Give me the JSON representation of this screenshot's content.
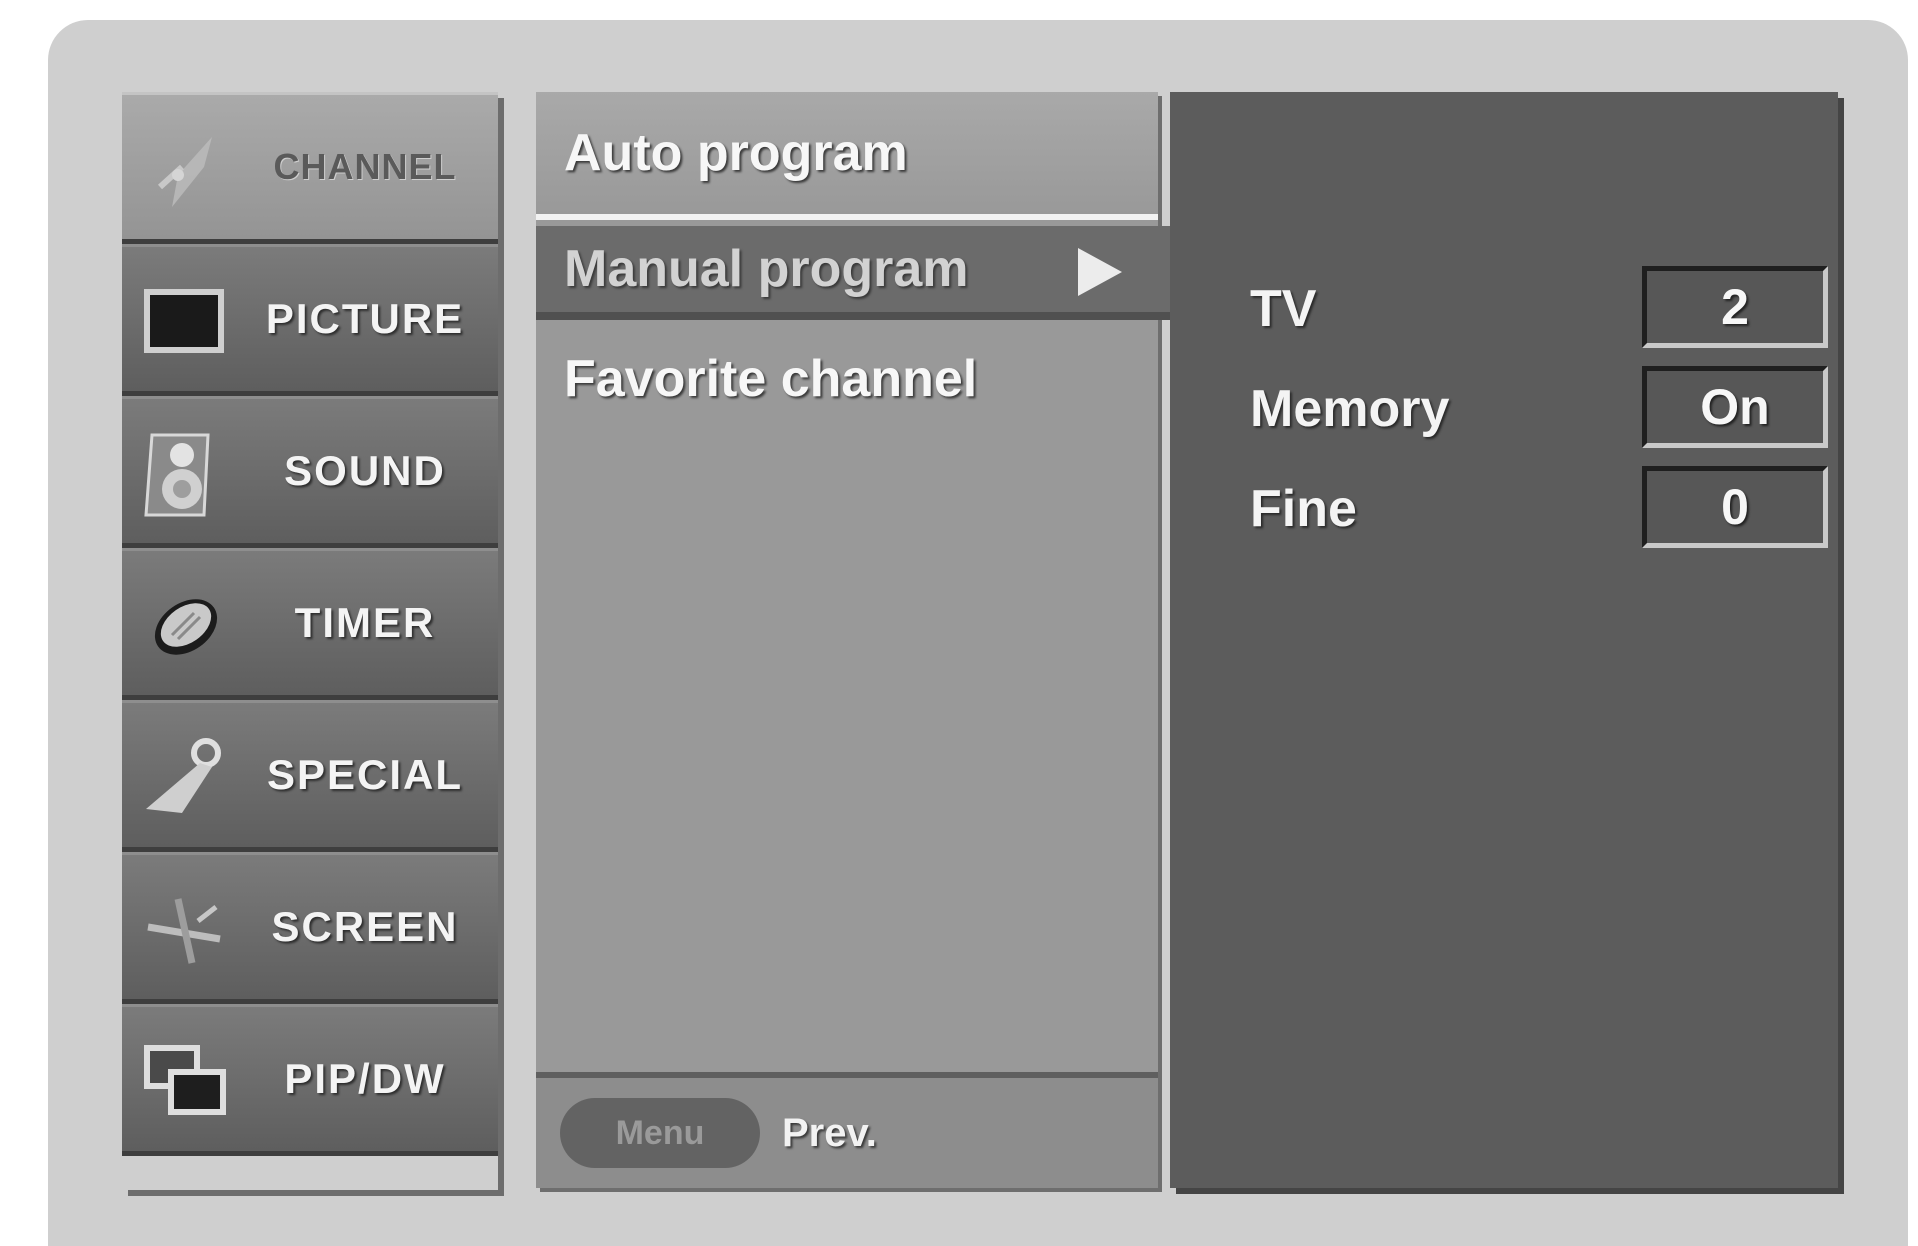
{
  "sidebar": {
    "items": [
      {
        "label": "CHANNEL",
        "icon": "antenna-icon",
        "active": true
      },
      {
        "label": "PICTURE",
        "icon": "monitor-icon",
        "active": false
      },
      {
        "label": "SOUND",
        "icon": "speaker-icon",
        "active": false
      },
      {
        "label": "TIMER",
        "icon": "clock-icon",
        "active": false
      },
      {
        "label": "SPECIAL",
        "icon": "key-icon",
        "active": false
      },
      {
        "label": "SCREEN",
        "icon": "tools-icon",
        "active": false
      },
      {
        "label": "PIP/DW",
        "icon": "pip-icon",
        "active": false
      }
    ]
  },
  "menu": {
    "items": [
      {
        "label": "Auto program"
      },
      {
        "label": "Manual program",
        "selected": true
      },
      {
        "label": "Favorite channel"
      }
    ],
    "footer": {
      "button_label": "Menu",
      "prev_label": "Prev."
    }
  },
  "settings": {
    "rows": [
      {
        "label": "TV",
        "value": "2"
      },
      {
        "label": "Memory",
        "value": "On"
      },
      {
        "label": "Fine",
        "value": "0"
      }
    ]
  },
  "colors": {
    "frame": "#cfcfcf",
    "menu_panel": "#999999",
    "settings_panel": "#5c5c5c",
    "selected_item": "#6b6b6b"
  }
}
